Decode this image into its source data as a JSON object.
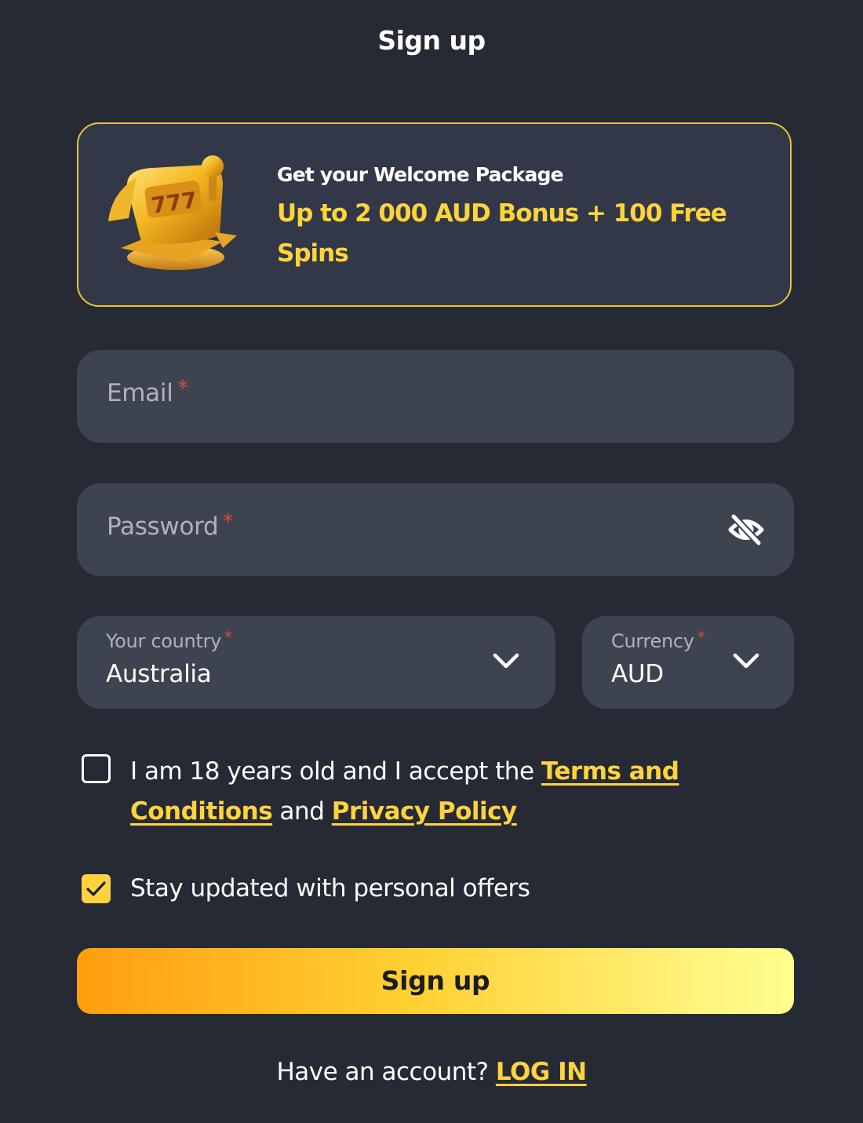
{
  "header": {
    "title": "Sign up"
  },
  "promo": {
    "icon": "slot-machine-icon",
    "kicker": "Get your Welcome Package",
    "headline": "Up to 2 000 AUD Bonus + 100 Free Spins"
  },
  "form": {
    "email": {
      "placeholder": "Email",
      "required_mark": "*",
      "value": ""
    },
    "password": {
      "placeholder": "Password",
      "required_mark": "*",
      "value": "",
      "toggle_icon": "eye-slash-icon"
    },
    "country": {
      "label": "Your country",
      "required_mark": "*",
      "selected": "Australia",
      "icon": "chevron-down-icon"
    },
    "currency": {
      "label": "Currency",
      "required_mark": "*",
      "selected": "AUD",
      "icon": "chevron-down-icon"
    },
    "terms": {
      "checked": false,
      "text_before": "I am 18 years old and I accept the ",
      "terms_link": "Terms and Conditions",
      "text_between": " and ",
      "privacy_link": "Privacy Policy"
    },
    "offers": {
      "checked": true,
      "text": "Stay updated with personal offers"
    },
    "submit_label": "Sign up"
  },
  "footer": {
    "prompt": "Have an account? ",
    "login_link": "LOG IN"
  },
  "colors": {
    "background": "#262a34",
    "field": "#3e4350",
    "accent": "#ffd33d",
    "required": "#e34a3a"
  }
}
